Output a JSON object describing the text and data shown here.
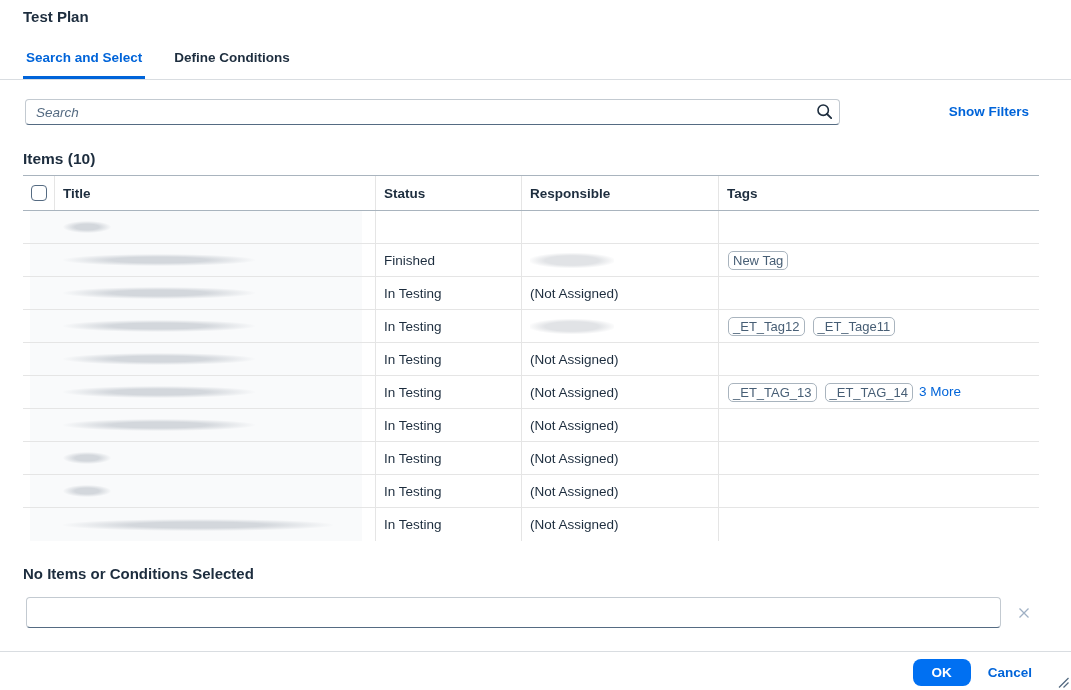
{
  "dialog": {
    "title": "Test Plan"
  },
  "tabs": [
    {
      "label": "Search and Select",
      "selected": true
    },
    {
      "label": "Define Conditions",
      "selected": false
    }
  ],
  "search": {
    "placeholder": "Search"
  },
  "show_filters": "Show Filters",
  "items": {
    "heading": "Items (10)",
    "select_all": {
      "checked": false
    },
    "columns": [
      "Title",
      "Status",
      "Responsible",
      "Tags"
    ],
    "rows": [
      {
        "kind": "short"
      },
      {
        "kind": "long",
        "status": "Finished",
        "responsible_hidden": true,
        "tags": [
          "New Tag"
        ]
      },
      {
        "kind": "long",
        "status": "In Testing",
        "responsible": "(Not Assigned)"
      },
      {
        "kind": "long",
        "status": "In Testing",
        "responsible_hidden": true,
        "tags": [
          "_ET_Tag12",
          "_ET_Tage11"
        ]
      },
      {
        "kind": "long",
        "status": "In Testing",
        "responsible": "(Not Assigned)"
      },
      {
        "kind": "long",
        "status": "In Testing",
        "responsible": "(Not Assigned)",
        "tags": [
          "_ET_TAG_13",
          "_ET_TAG_14"
        ],
        "more": "3 More"
      },
      {
        "kind": "long",
        "status": "In Testing",
        "responsible": "(Not Assigned)"
      },
      {
        "kind": "short",
        "status": "In Testing",
        "responsible": "(Not Assigned)"
      },
      {
        "kind": "short",
        "status": "In Testing",
        "responsible": "(Not Assigned)"
      },
      {
        "kind": "longer",
        "status": "In Testing",
        "responsible": "(Not Assigned)"
      }
    ]
  },
  "selection": {
    "heading": "No Items or Conditions Selected"
  },
  "buttons": [
    {
      "label": "OK",
      "kind": "primary"
    },
    {
      "label": "Cancel",
      "kind": "transparent"
    }
  ]
}
